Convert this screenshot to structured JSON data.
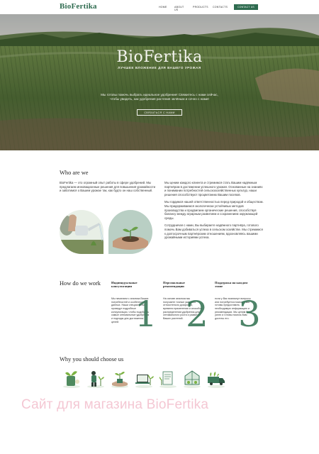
{
  "header": {
    "logo": "BioFertika",
    "nav": [
      "HOME",
      "ABOUT US",
      "PRODUCTS",
      "CONTACTS"
    ],
    "cta": "CONTACT US"
  },
  "hero": {
    "logo": "BioFertika",
    "tagline": "ЛУЧШЕЕ ВЛОЖЕНИЕ ДЛЯ ВАШЕГО УРОЖАЯ",
    "text": "Мы готовы помочь выбрать идеальное удобрение! Свяжитесь с нами сейчас, чтобы увидеть, как удобрения растения зелёным и сочно с нами!",
    "button": "СВЯЗАТЬСЯ С НАМИ"
  },
  "who": {
    "title": "Who are we",
    "left": "BioFertika — это огромный опыт работы в сфере удобрений. Мы предлагаем инновационные решения для повышения урожайности и заботимся о Вашем урожае так, как будто он наш собственный.",
    "right": [
      "Мы ценим каждого клиента и стремимся стать Вашим надёжным партнёром в достижении успешного урожая. Основанные на знаниях и понимании потребностей сельскохозяйственных культур, наши решения способствуют процветанию Вашим посевов.",
      "Мы гордимся нашей ответственностью перед природой и обществом. Мы придерживаемся экологически устойчивых методов производства и продвигаем органические решения, способствуя балансу между аграрным развитием и сохранением окружающей среды.",
      "Сотрудничая с нами, Вы выбираете надёжного партнёра, готового помочь Вам добиваться успеха в сельском хозяйстве. Мы стремимся к долгосрочным партнёрским отношениям, вдохновляясь вашими урожайными историями успеха."
    ]
  },
  "how": {
    "title": "How do we work",
    "steps": [
      {
        "title": "Индивидуальные консультации",
        "text": "Мы начинаем с анализа Ваших потребностей и особенностей данных. Наши специалисты проведут подробные консультации, чтобы подобрать самые оптимальные удобрения и подходы для достижения целей.",
        "number": "1"
      },
      {
        "title": "Персональные рекомендации",
        "text": "На основе анализа мы получаете точные указания относительно дозировки, времени применения и способов распределения удобрения для оптимального роста и развития Ваших растений.",
        "number": "2"
      },
      {
        "title": "Поддержка на каждом этапе",
        "text": "если у Вас возникнут вопросы или потребуется помощь, мы готовы предоставить необходимую информацию и рекомендации. Мы ценим Ваш успех и готовы помочь Вам достичь его.",
        "number": "3"
      }
    ]
  },
  "why": {
    "title": "Why you should choose us",
    "icons": [
      "seedling-bag-icon",
      "farmer-plant-icon",
      "plant-hands-icon",
      "laptop-plant-icon",
      "document-plant-icon",
      "greenhouse-icon",
      "truck-plants-icon"
    ]
  },
  "watermark": "Сайт для магазина BioFertika",
  "colors": {
    "brand_green": "#2e6b4f",
    "number_green": "#3e7a5c",
    "watermark_pink": "#f4c7d3"
  }
}
